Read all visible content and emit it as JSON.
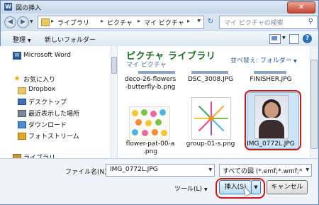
{
  "window": {
    "title": "図の挿入",
    "close_label": "✕"
  },
  "nav": {
    "back_icon": "back-arrow-icon",
    "forward_icon": "forward-arrow-icon",
    "address": [
      "ライブラリ",
      "ピクチャ",
      "マイ ピクチャ"
    ],
    "refresh_label": "↻",
    "search_placeholder": "マイ ピクチャの検索"
  },
  "toolbar": {
    "organize": "整理",
    "new_folder": "新しいフォルダー"
  },
  "sidebar": {
    "items": [
      {
        "label": "Microsoft Word",
        "icon": "word-icon"
      },
      {
        "label": "お気に入り",
        "icon": "star-icon"
      },
      {
        "label": "Dropbox",
        "icon": "folder-icon"
      },
      {
        "label": "デスクトップ",
        "icon": "desktop-icon"
      },
      {
        "label": "最近表示した場所",
        "icon": "recent-places-icon"
      },
      {
        "label": "ダウンロード",
        "icon": "downloads-icon"
      },
      {
        "label": "フォトストリーム",
        "icon": "photostream-icon"
      },
      {
        "label": "ライブラリ",
        "icon": "library-icon"
      }
    ]
  },
  "library": {
    "title": "ピクチャ ライブラリ",
    "subtitle": "マイ ピクチャ",
    "arrange_label": "並べ替え:",
    "arrange_value": "フォルダー"
  },
  "files": [
    {
      "name": "deco-26-flowers\n-butterfly-b.png"
    },
    {
      "name": "DSC_3008.JPG"
    },
    {
      "name": "FINISHER.JPG"
    },
    {
      "name": "flower-pat-00-a\n.png"
    },
    {
      "name": "group-01-s.png"
    },
    {
      "name": "IMG_0772L.JPG"
    }
  ],
  "bottom": {
    "filename_label": "ファイル名(N):",
    "filename_value": "IMG_0772L.JPG",
    "filter_value": "すべての図 (*.emf;*.wmf;*.j",
    "tools_label": "ツール(L)",
    "insert_label": "挿入(S)",
    "cancel_label": "キャンセル"
  },
  "colors": {
    "highlight_ring": "#c91a1a",
    "library_title": "#1e6a25",
    "selection": "#cde4f7"
  }
}
